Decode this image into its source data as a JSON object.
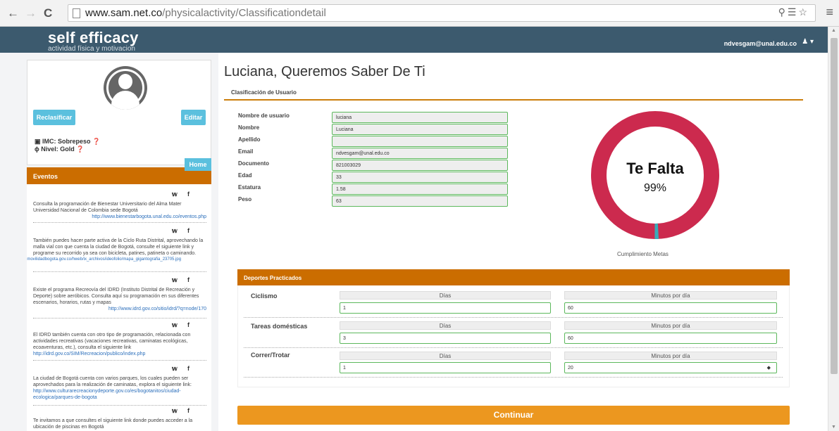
{
  "browser": {
    "url_host": "www.sam.net.co",
    "url_path": "/physicalactivity/Classificationdetail"
  },
  "header": {
    "brand_title": "self efficacy",
    "brand_subtitle": "actividad física y motivacion",
    "user_email": "ndvesgam@unal.edu.co"
  },
  "profile": {
    "reclasificar_label": "Reclasificar",
    "editar_label": "Editar",
    "imc": "IMC: Sobrepeso",
    "nivel": "Nivel: Gold",
    "home_label": "Home"
  },
  "eventos": {
    "title": "Eventos",
    "items": [
      {
        "text": "Consulta la programación de Bienestar Universitario del Alma Mater Universidad Nacional de Colombia sede Bogotá",
        "link": "http://www.bienestarbogota.unal.edu.co/eventos.php"
      },
      {
        "text": "También puedes hacer parte activa de la Ciclo Ruta Distrital, aprovechando la malla vial con que cuenta la ciudad de Bogotá, consulte el siguiente link y programe su recorrido ya sea con bicicleta, patines, patineta o caminando.",
        "link": "http://www.movilidadbogota.gov.co/hweb/ix_archivos/ideofolio/mapa_gigantografia_23705.jpg"
      },
      {
        "text": "Existe el programa Recreovía del IDRD (Instituto Distrital de Recreación y Deporte) sobre aeróbicos. Consulta aquí su programación en sus diferentes escenarios, horarios, rutas y mapas",
        "link": "http://www.idrd.gov.co/sitio/idrd/?q=node/170"
      },
      {
        "text": "El IDRD también cuenta con otro tipo de programación, relacionada con actividades recreativas (vacaciones recreativas, caminatas ecológicas, ecoaventuras, etc.), consulta el siguiente link",
        "link": "http://idrd.gov.co/SIM/Recreacion/publico/index.php"
      },
      {
        "text": "La ciudad de Bogotá cuenta con varios parques, los cuales pueden ser aprovechados para la realización de caminatas, explora el siguiente link:",
        "link": "http://www.culturarecreacionydeporte.gov.co/es/bogotanitos/ciudad-ecologica/parques-de-bogota"
      },
      {
        "text": "Te invitamos a que consultes el siguiente link donde puedes acceder a la ubicación de piscinas en Bogotá",
        "link": ""
      }
    ]
  },
  "main": {
    "page_title": "Luciana, Queremos Saber De Ti",
    "section_label": "Clasificación de Usuario",
    "fields": [
      {
        "label": "Nombre de usuario",
        "value": "luciana"
      },
      {
        "label": "Nombre",
        "value": "Luciana"
      },
      {
        "label": "Apellido",
        "value": ""
      },
      {
        "label": "Email",
        "value": "ndvesgam@unal.edu.co"
      },
      {
        "label": "Documento",
        "value": "821003029"
      },
      {
        "label": "Edad",
        "value": "33"
      },
      {
        "label": "Estatura",
        "value": "1.58"
      },
      {
        "label": "Peso",
        "value": "63"
      }
    ],
    "donut": {
      "title": "Te Falta",
      "percent_text": "99%",
      "remaining_fraction": 0.99,
      "completed_fraction": 0.01,
      "caption": "Cumplimiento Metas",
      "color_remaining": "#cc2a4e",
      "color_completed": "#3aaab8"
    },
    "deportes": {
      "title": "Deportes Practicados",
      "dias_label": "Días",
      "minutos_label": "Minutos por día",
      "rows": [
        {
          "name": "Ciclismo",
          "dias": "1",
          "minutos": "60"
        },
        {
          "name": "Tareas domésticas",
          "dias": "3",
          "minutos": "60"
        },
        {
          "name": "Correr/Trotar",
          "dias": "1",
          "minutos": "20"
        }
      ]
    },
    "continue_label": "Continuar"
  },
  "colors": {
    "header_bg": "#3c5a6e",
    "accent_orange": "#cb6d00",
    "button_teal": "#5bc0de",
    "button_continue": "#ec971f",
    "input_border": "#5cb85c"
  }
}
